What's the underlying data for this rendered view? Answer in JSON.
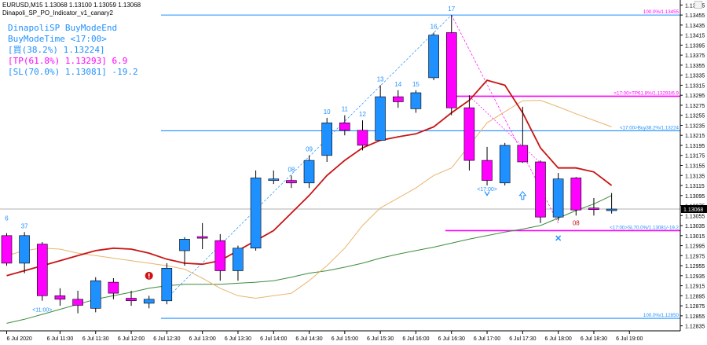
{
  "header": {
    "line1": "EURUSD,M15  1.13068 1.13100 1.13059 1.13068",
    "line2": "Dinapoli_SP_PO_Indicator_v1_canary2"
  },
  "info_panel": [
    {
      "text": "DinapoliSP BuyModeEnd",
      "color": "#1e90ff"
    },
    {
      "text": "BuyModeTime <17:00>",
      "color": "#1e90ff"
    },
    {
      "text": "[買(38.2%) 1.13224]",
      "color": "#1e90ff"
    },
    {
      "text": "[TP(61.8%) 1.13293] 6.9",
      "color": "#ff00ff"
    },
    {
      "text": "[SL(70.0%) 1.13081] -19.2",
      "color": "#1e90ff"
    }
  ],
  "colors": {
    "bull": "#1e90ff",
    "bear": "#ff00ff",
    "ma_red": "#c81414",
    "ma_tan": "#e8b46e",
    "ma_green": "#3c8c3c",
    "level_blue": "#1e90ff",
    "level_magenta": "#ff00ff",
    "axis_text": "#000000",
    "current_price_bg": "#000000"
  },
  "chart_data": {
    "type": "candlestick",
    "symbol": "EURUSD",
    "timeframe": "M15",
    "ylim": [
      1.12825,
      1.13485
    ],
    "y_ticks": [
      "1.13475",
      "1.13455",
      "1.13435",
      "1.13415",
      "1.13395",
      "1.13375",
      "1.13355",
      "1.13335",
      "1.13315",
      "1.13295",
      "1.13275",
      "1.13255",
      "1.13235",
      "1.13215",
      "1.13195",
      "1.13175",
      "1.13155",
      "1.13135",
      "1.13115",
      "1.13095",
      "1.13075",
      "1.13055",
      "1.13035",
      "1.13015",
      "1.12995",
      "1.12975",
      "1.12955",
      "1.12935",
      "1.12915",
      "1.12895",
      "1.12875",
      "1.12855",
      "1.12835"
    ],
    "x_ticks": [
      {
        "index": 0,
        "label": "6 Jul 2020"
      },
      {
        "index": 3,
        "label": "6 Jul 11:00"
      },
      {
        "index": 5,
        "label": "6 Jul 11:30"
      },
      {
        "index": 7,
        "label": "6 Jul 12:00"
      },
      {
        "index": 9,
        "label": "6 Jul 12:30"
      },
      {
        "index": 11,
        "label": "6 Jul 13:00"
      },
      {
        "index": 13,
        "label": "6 Jul 13:30"
      },
      {
        "index": 15,
        "label": "6 Jul 14:00"
      },
      {
        "index": 17,
        "label": "6 Jul 14:30"
      },
      {
        "index": 19,
        "label": "6 Jul 15:00"
      },
      {
        "index": 21,
        "label": "6 Jul 15:30"
      },
      {
        "index": 23,
        "label": "6 Jul 16:00"
      },
      {
        "index": 25,
        "label": "6 Jul 16:30"
      },
      {
        "index": 27,
        "label": "6 Jul 17:00"
      },
      {
        "index": 29,
        "label": "6 Jul 17:30"
      },
      {
        "index": 31,
        "label": "6 Jul 18:00"
      },
      {
        "index": 33,
        "label": "6 Jul 18:30"
      },
      {
        "index": 35,
        "label": "6 Jul 19:00"
      }
    ],
    "candles": [
      {
        "o": 1.13015,
        "h": 1.1302,
        "l": 1.12955,
        "c": 1.1296
      },
      {
        "o": 1.1296,
        "h": 1.13022,
        "l": 1.1294,
        "c": 1.13015
      },
      {
        "o": 1.12998,
        "h": 1.13002,
        "l": 1.12885,
        "c": 1.12895
      },
      {
        "o": 1.12895,
        "h": 1.1291,
        "l": 1.12875,
        "c": 1.12888
      },
      {
        "o": 1.12888,
        "h": 1.12905,
        "l": 1.1286,
        "c": 1.12876
      },
      {
        "o": 1.1287,
        "h": 1.12932,
        "l": 1.12862,
        "c": 1.12925
      },
      {
        "o": 1.12922,
        "h": 1.1293,
        "l": 1.12888,
        "c": 1.129
      },
      {
        "o": 1.1289,
        "h": 1.12905,
        "l": 1.12875,
        "c": 1.12885
      },
      {
        "o": 1.1288,
        "h": 1.12895,
        "l": 1.1287,
        "c": 1.12888
      },
      {
        "o": 1.12885,
        "h": 1.1296,
        "l": 1.12878,
        "c": 1.1295
      },
      {
        "o": 1.12985,
        "h": 1.13012,
        "l": 1.12955,
        "c": 1.13008
      },
      {
        "o": 1.13013,
        "h": 1.1304,
        "l": 1.12988,
        "c": 1.1301
      },
      {
        "o": 1.13005,
        "h": 1.13018,
        "l": 1.12925,
        "c": 1.12945
      },
      {
        "o": 1.12945,
        "h": 1.12995,
        "l": 1.12925,
        "c": 1.1299
      },
      {
        "o": 1.1299,
        "h": 1.13145,
        "l": 1.12985,
        "c": 1.1313
      },
      {
        "o": 1.13128,
        "h": 1.13145,
        "l": 1.13118,
        "c": 1.13128
      },
      {
        "o": 1.13125,
        "h": 1.13135,
        "l": 1.1311,
        "c": 1.1312
      },
      {
        "o": 1.1312,
        "h": 1.13175,
        "l": 1.1311,
        "c": 1.13165
      },
      {
        "o": 1.13175,
        "h": 1.1325,
        "l": 1.13162,
        "c": 1.1324
      },
      {
        "o": 1.1324,
        "h": 1.13255,
        "l": 1.13215,
        "c": 1.13225
      },
      {
        "o": 1.13225,
        "h": 1.13245,
        "l": 1.13185,
        "c": 1.13195
      },
      {
        "o": 1.13205,
        "h": 1.13315,
        "l": 1.13205,
        "c": 1.13292
      },
      {
        "o": 1.13292,
        "h": 1.13305,
        "l": 1.1327,
        "c": 1.13282
      },
      {
        "o": 1.13268,
        "h": 1.13305,
        "l": 1.1326,
        "c": 1.133
      },
      {
        "o": 1.1333,
        "h": 1.1342,
        "l": 1.13325,
        "c": 1.13415
      },
      {
        "o": 1.1342,
        "h": 1.13455,
        "l": 1.13255,
        "c": 1.1327
      },
      {
        "o": 1.1327,
        "h": 1.13295,
        "l": 1.13145,
        "c": 1.13165
      },
      {
        "o": 1.13165,
        "h": 1.13192,
        "l": 1.13115,
        "c": 1.13125
      },
      {
        "o": 1.1312,
        "h": 1.132,
        "l": 1.13115,
        "c": 1.13195
      },
      {
        "o": 1.13195,
        "h": 1.13272,
        "l": 1.1316,
        "c": 1.13162
      },
      {
        "o": 1.13162,
        "h": 1.13165,
        "l": 1.1304,
        "c": 1.13052
      },
      {
        "o": 1.13052,
        "h": 1.1314,
        "l": 1.13045,
        "c": 1.13128
      },
      {
        "o": 1.1313,
        "h": 1.13132,
        "l": 1.13055,
        "c": 1.13066
      },
      {
        "o": 1.1307,
        "h": 1.1309,
        "l": 1.13055,
        "c": 1.13068
      },
      {
        "o": 1.13068,
        "h": 1.131,
        "l": 1.13059,
        "c": 1.13068
      }
    ],
    "ma_red": [
      1.12935,
      1.12945,
      1.12955,
      1.12965,
      1.12975,
      1.12985,
      1.1299,
      1.12988,
      1.1298,
      1.12968,
      1.1296,
      1.12958,
      1.12965,
      1.12985,
      1.13005,
      1.13025,
      1.1306,
      1.13095,
      1.13135,
      1.13165,
      1.1319,
      1.13205,
      1.13212,
      1.13218,
      1.13232,
      1.1326,
      1.13285,
      1.13325,
      1.13315,
      1.1326,
      1.1319,
      1.1315,
      1.1315,
      1.13142,
      1.13115
    ],
    "ma_tan": [
      1.12975,
      1.12985,
      1.1299,
      1.12988,
      1.1298,
      1.12975,
      1.1297,
      1.12965,
      1.1296,
      1.12955,
      1.12948,
      1.1293,
      1.1291,
      1.12895,
      1.1289,
      1.12895,
      1.129,
      1.12925,
      1.12955,
      1.1299,
      1.13035,
      1.1307,
      1.1309,
      1.1311,
      1.13135,
      1.1315,
      1.13195,
      1.1324,
      1.13262,
      1.13284,
      1.13285,
      1.13272,
      1.13258,
      1.13245,
      1.13232
    ],
    "ma_green": [
      1.1284,
      1.12848,
      1.12858,
      1.12868,
      1.12878,
      1.12888,
      1.12895,
      1.12902,
      1.1291,
      1.12915,
      1.12918,
      1.12918,
      1.12918,
      1.1292,
      1.12922,
      1.12925,
      1.12932,
      1.1294,
      1.12945,
      1.12952,
      1.1296,
      1.1297,
      1.12978,
      1.12985,
      1.12992,
      1.13,
      1.13008,
      1.13015,
      1.13022,
      1.13028,
      1.13035,
      1.1305,
      1.13065,
      1.13078,
      1.13095
    ],
    "levels": [
      {
        "price": 1.13455,
        "color": "level_blue",
        "label": "100.0%/1.13455",
        "label_color": "level_magenta"
      },
      {
        "price": 1.13293,
        "color": "level_magenta",
        "label": "<17:00>TP61.8%/1.13293/6.9",
        "label_color": "level_magenta"
      },
      {
        "price": 1.13224,
        "color": "level_blue",
        "label": "<17:00>Buy38.2%/1.13224",
        "label_color": "level_blue"
      },
      {
        "price": 1.13025,
        "color": "level_magenta",
        "label": "<17:00>SL70.0%/1.13081/-19.2",
        "label_color": "level_blue"
      },
      {
        "price": 1.1285,
        "color": "level_blue",
        "label": "100.0%/1.12850",
        "label_color": "level_blue"
      }
    ],
    "wave_numbers": [
      {
        "i": 0,
        "text": "6"
      },
      {
        "i": 1,
        "text": "37"
      },
      {
        "i": 16,
        "text": "08"
      },
      {
        "i": 17,
        "text": "09"
      },
      {
        "i": 18,
        "text": "10"
      },
      {
        "i": 19,
        "text": "11"
      },
      {
        "i": 20,
        "text": "12"
      },
      {
        "i": 21,
        "text": "13"
      },
      {
        "i": 22,
        "text": "14"
      },
      {
        "i": 23,
        "text": "15"
      },
      {
        "i": 24,
        "text": "16"
      },
      {
        "i": 25,
        "text": "17"
      },
      {
        "i": 32,
        "text": "08"
      }
    ],
    "time_labels": [
      {
        "i": 2,
        "text": "<11:00>"
      },
      {
        "i": 27,
        "text": "<17:00>"
      }
    ],
    "current_price": "1.13068"
  }
}
